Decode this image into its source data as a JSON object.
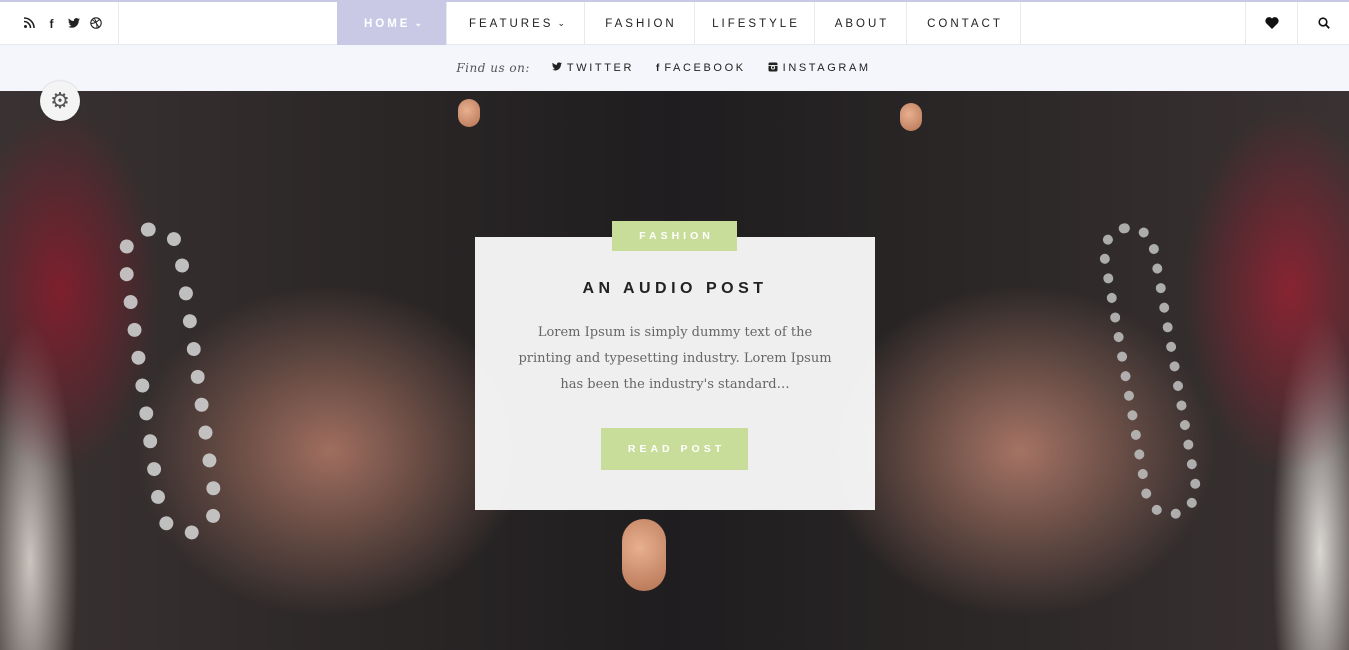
{
  "topnav": {
    "social_icons": [
      {
        "name": "rss",
        "glyph": "⊃"
      },
      {
        "name": "facebook",
        "glyph": "f"
      },
      {
        "name": "twitter",
        "glyph": "🐦"
      },
      {
        "name": "dribbble",
        "glyph": "⊛"
      }
    ],
    "menu": [
      {
        "label": "HOME",
        "chevron": "⌄",
        "active": true
      },
      {
        "label": "FEATURES",
        "chevron": "⌄",
        "active": false
      },
      {
        "label": "FASHION",
        "active": false
      },
      {
        "label": "LIFESTYLE",
        "active": false
      },
      {
        "label": "ABOUT",
        "active": false
      },
      {
        "label": "CONTACT",
        "active": false
      }
    ],
    "right_icons": {
      "heart": "♥",
      "search": "⚲"
    }
  },
  "findbar": {
    "label": "Find us on:",
    "links": [
      {
        "icon": "twitter",
        "glyph": "✦",
        "label": "TWITTER"
      },
      {
        "icon": "facebook",
        "glyph": "f",
        "label": "FACEBOOK"
      },
      {
        "icon": "instagram",
        "glyph": "◙",
        "label": "INSTAGRAM"
      }
    ]
  },
  "hero": {
    "settings_glyph": "⚙",
    "post": {
      "category": "FASHION",
      "title": "AN AUDIO POST",
      "excerpt": "Lorem Ipsum is simply dummy text of the printing and typesetting industry. Lorem Ipsum has been the industry's standard…",
      "button_label": "READ POST"
    }
  },
  "colors": {
    "accent_lavender": "#c9c9e6",
    "accent_green": "#c8dd9a",
    "findbar_bg": "#f5f6fc"
  }
}
